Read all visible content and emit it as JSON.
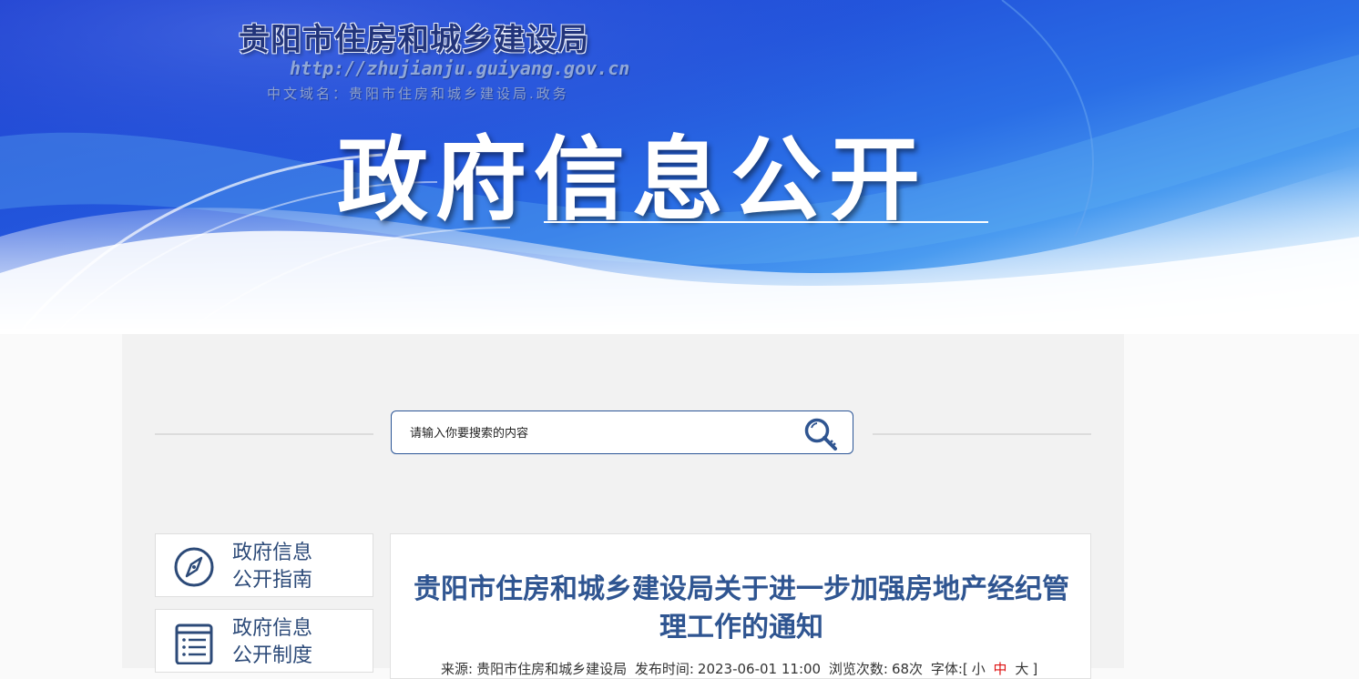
{
  "banner": {
    "site_name": "贵阳市住房和城乡建设局",
    "url": "http://zhujianju.guiyang.gov.cn",
    "chinese_domain": "中文域名：贵阳市住房和城乡建设局.政务",
    "title": "政府信息公开"
  },
  "search": {
    "placeholder": "请输入你要搜索的内容",
    "icon": "search-icon"
  },
  "sidebar": {
    "items": [
      {
        "label_line1": "政府信息",
        "label_line2": "公开指南",
        "icon": "compass-icon"
      },
      {
        "label_line1": "政府信息",
        "label_line2": "公开制度",
        "icon": "document-list-icon"
      }
    ]
  },
  "article": {
    "title": "贵阳市住房和城乡建设局关于进一步加强房地产经纪管理工作的通知",
    "meta": {
      "source_label": "来源:",
      "source": "贵阳市住房和城乡建设局",
      "time_label": "发布时间:",
      "time": "2023-06-01 11:00",
      "views_label": "浏览次数:",
      "views": "68次",
      "font_label": "字体:[",
      "font_small": "小",
      "font_medium": "中",
      "font_large": "大",
      "font_close": "]"
    }
  },
  "colors": {
    "accent": "#2f5591",
    "nav_text": "#2c4a78",
    "search_border": "#2b5596"
  }
}
